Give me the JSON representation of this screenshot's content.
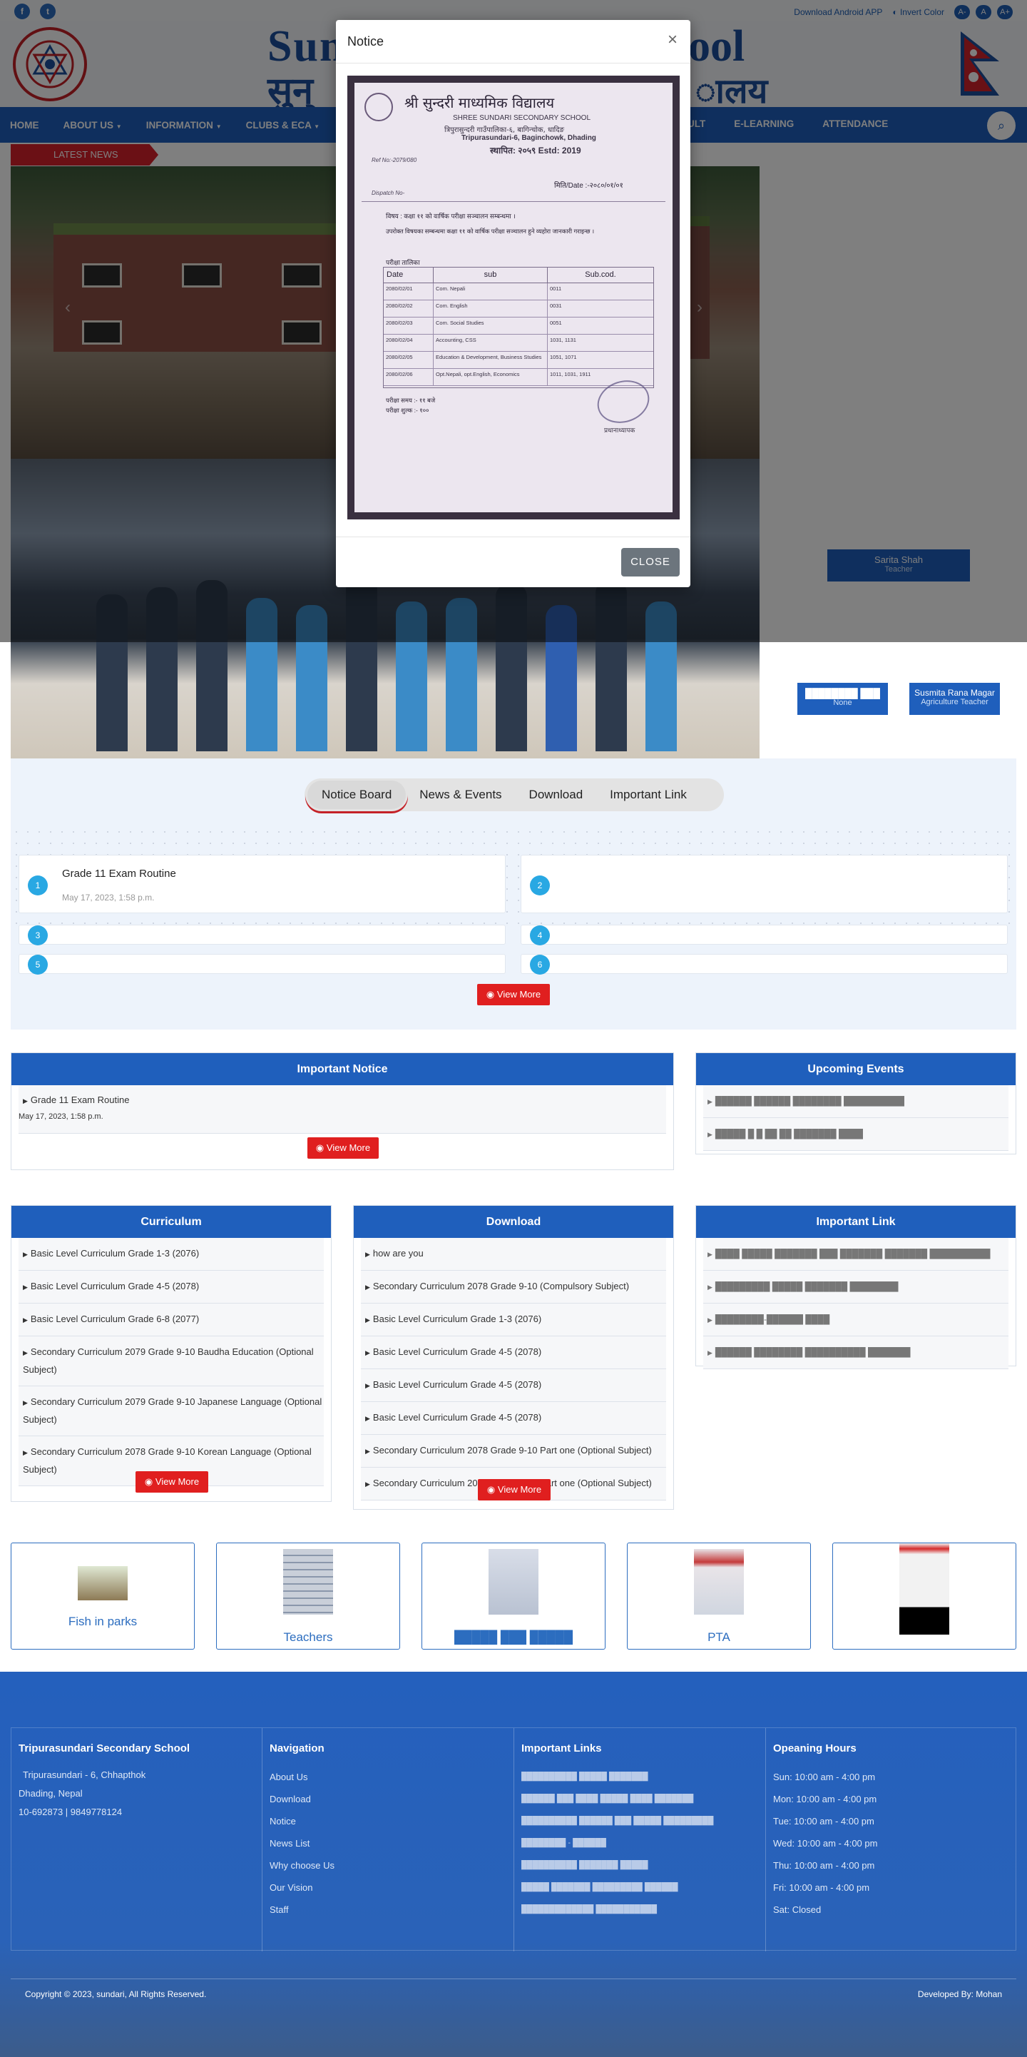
{
  "topbar": {
    "facebook": "f",
    "twitter": "t",
    "download_app": "Download Android APP",
    "invert_color": "Invert Color",
    "font_smaller": "A-",
    "font_normal": "A",
    "font_larger": "A+"
  },
  "header": {
    "school_name_en_left": "Sun",
    "school_name_en_right": "ool",
    "school_name_np_left": "सुन्",
    "school_name_np_right": "ालय"
  },
  "nav": {
    "items": [
      "HOME",
      "ABOUT US",
      "INFORMATION",
      "CLUBS & ECA",
      "D"
    ],
    "right_items": [
      "SULT",
      "E-LEARNING",
      "ATTENDANCE"
    ]
  },
  "latest_news": "LATEST NEWS",
  "staff": {
    "card1_name": "Sarita Shah",
    "card1_role": "Teacher",
    "card2_name": "████████ ███",
    "card2_role": "None",
    "card3_name": "Susmita Rana Magar",
    "card3_role": "Agriculture Teacher"
  },
  "modal": {
    "title": "Notice",
    "close_x": "×",
    "close_label": "CLOSE",
    "document": {
      "heading": "श्री सुन्दरी माध्यमिक विद्यालय",
      "subheading": "SHREE SUNDARI SECONDARY SCHOOL",
      "address_np": "त्रिपुरासुन्दरी गाउँपालिका-६, बागिन्चोक, धादिङ",
      "address_en": "Tripurasundari-6, Baginchowk, Dhading",
      "established": "स्थापित: २०५९  Estd: 2019",
      "ref_no": "Ref No:-2079/080",
      "date": "मिति/Date :-२०८०/०१/०१",
      "dispatch": "Dispatch No-",
      "subject": "विषय : कक्षा ११ को वार्षिक परीक्षा सञ्चालन सम्बन्धमा ।",
      "body": "उपरोक्त विषयका सम्बन्धमा कक्षा ११ को वार्षिक परीक्षा सञ्चालन हुने व्यहोरा जानकारी गराइन्छ ।",
      "table_title": "परीक्षा तालिका",
      "col_date": "Date",
      "col_sub": "sub",
      "col_code": "Sub.cod.",
      "rows": [
        {
          "date": "2080/02/01",
          "sub": "Com. Nepali",
          "code": "0011"
        },
        {
          "date": "2080/02/02",
          "sub": "Com. English",
          "code": "0031"
        },
        {
          "date": "2080/02/03",
          "sub": "Com. Social Studies",
          "code": "0051"
        },
        {
          "date": "2080/02/04",
          "sub": "Accounting, CSS",
          "code": "1031, 1131"
        },
        {
          "date": "2080/02/05",
          "sub": "Education & Development, Business Studies",
          "code": "1051, 1071"
        },
        {
          "date": "2080/02/06",
          "sub": "Opt.Nepali, opt.English, Economics",
          "code": "1011, 1031, 1911"
        }
      ],
      "exam_time": "परीक्षा समय :- ११ बजे",
      "exam_fee": "परीक्षा शुल्क :- १००",
      "signature": "प्रधानाध्यापक"
    }
  },
  "tabs": [
    "Notice Board",
    "News & Events",
    "Download",
    "Important Link"
  ],
  "notice_board": [
    {
      "num": "1",
      "title": "Grade 11 Exam Routine",
      "date": "May 17, 2023, 1:58 p.m."
    },
    {
      "num": "2",
      "title": "",
      "date": ""
    },
    {
      "num": "3",
      "title": "",
      "date": ""
    },
    {
      "num": "4",
      "title": "",
      "date": ""
    },
    {
      "num": "5",
      "title": "",
      "date": ""
    },
    {
      "num": "6",
      "title": "",
      "date": ""
    }
  ],
  "view_more": "View More",
  "important_notice": {
    "title": "Important Notice",
    "item": "Grade 11 Exam Routine",
    "date": "May 17, 2023, 1:58 p.m."
  },
  "upcoming_events": {
    "title": "Upcoming Events",
    "items": [
      "██████ ██████ ████████ ██████████",
      "█████ █ █ ██ ██ ███████ ████"
    ]
  },
  "curriculum": {
    "title": "Curriculum",
    "items": [
      "Basic Level Curriculum Grade 1-3 (2076)",
      "Basic Level Curriculum Grade 4-5 (2078)",
      "Basic Level Curriculum Grade 6-8 (2077)",
      "Secondary Curriculum 2079 Grade 9-10 Baudha Education (Optional Subject)",
      "Secondary Curriculum 2079 Grade 9-10 Japanese Language (Optional Subject)",
      "Secondary Curriculum 2078 Grade 9-10 Korean Language (Optional Subject)"
    ]
  },
  "download": {
    "title": "Download",
    "items": [
      "how are you",
      "Secondary Curriculum 2078 Grade 9-10 (Compulsory Subject)",
      "Basic Level Curriculum Grade 1-3 (2076)",
      "Basic Level Curriculum Grade 4-5 (2078)",
      "Basic Level Curriculum Grade 4-5 (2078)",
      "Basic Level Curriculum Grade 4-5 (2078)",
      "Secondary Curriculum 2078 Grade 9-10 Part one (Optional Subject)",
      "Secondary Curriculum 2078 Grade 9-10 Part one (Optional Subject)"
    ]
  },
  "important_link": {
    "title": "Important Link",
    "items": [
      "████ █████ ███████ ███ ███████ ███████ ██████████",
      "█████████ █████ ███████ ████████",
      "████████-██████ ████",
      "██████ ████████ ██████████ ███████"
    ]
  },
  "gallery": [
    {
      "caption": "Fish in parks"
    },
    {
      "caption": "Teachers"
    },
    {
      "caption": "█████ ███ █████"
    },
    {
      "caption": "PTA"
    },
    {
      "caption": ""
    }
  ],
  "footer": {
    "school": "Tripurasundari Secondary School",
    "address1": "Tripurasundari - 6, Chhapthok",
    "address2": "Dhading, Nepal",
    "phone": "10-692873 | 9849778124",
    "nav_title": "Navigation",
    "nav_items": [
      "About Us",
      "Download",
      "Notice",
      "News List",
      "Why choose Us",
      "Our Vision",
      "Staff"
    ],
    "links_title": "Important Links",
    "links": [
      "██████████ █████ ███████",
      "██████ ███ ████ █████ ████ ███████",
      "██████████ ██████ ███ █████ █████████ ████████ - ██████",
      "██████████ ███████ █████",
      "█████ ███████ █████████ ██████",
      "█████████████ ███████████"
    ],
    "hours_title": "Opeaning Hours",
    "hours": [
      "Sun: 10:00 am - 4:00 pm",
      "Mon: 10:00 am - 4:00 pm",
      "Tue: 10:00 am - 4:00 pm",
      "Wed: 10:00 am - 4:00 pm",
      "Thu: 10:00 am - 4:00 pm",
      "Fri: 10:00 am - 4:00 pm",
      "Sat: Closed"
    ],
    "copyright": "Copyright © 2023, sundari, All Rights Reserved.",
    "developer": "Developed By: Mohan"
  }
}
